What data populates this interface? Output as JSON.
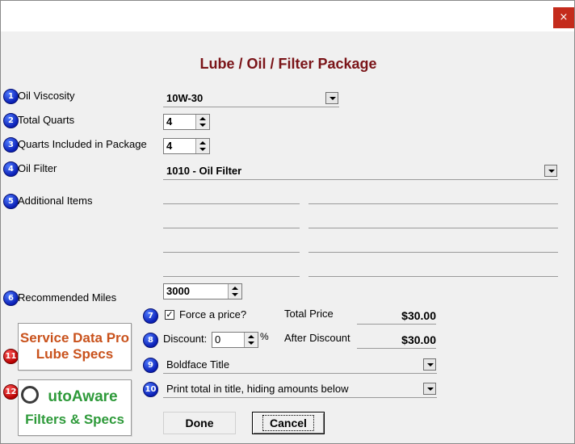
{
  "window": {
    "close_glyph": "×"
  },
  "title": "Lube / Oil / Filter Package",
  "fields": {
    "oil_viscosity": {
      "num": "1",
      "label": "Oil Viscosity",
      "value": "10W-30"
    },
    "total_quarts": {
      "num": "2",
      "label": "Total Quarts",
      "value": "4"
    },
    "quarts_included": {
      "num": "3",
      "label": "Quarts Included in Package",
      "value": "4"
    },
    "oil_filter": {
      "num": "4",
      "label": "Oil Filter",
      "value": "1010 - Oil Filter"
    },
    "additional_items": {
      "num": "5",
      "label": "Additional Items"
    },
    "recommended_miles": {
      "num": "6",
      "label": "Recommended Miles",
      "value": "3000"
    }
  },
  "pricing": {
    "force_num": "7",
    "force_label": "Force a price?",
    "force_checked_glyph": "✓",
    "total_price_label": "Total Price",
    "total_price": "$30.00",
    "discount_num": "8",
    "discount_label": "Discount:",
    "discount_value": "0",
    "percent": "%",
    "after_discount_label": "After Discount",
    "after_discount": "$30.00"
  },
  "title_style": {
    "num": "9",
    "value": "Boldface Title"
  },
  "print_option": {
    "num": "10",
    "value": "Print total in title, hiding amounts below"
  },
  "logos": {
    "service_data": {
      "num": "11",
      "line1": "Service Data Pro",
      "line2": "Lube Specs"
    },
    "autoaware": {
      "num": "12",
      "line1": "utoAware",
      "line2": "Filters & Specs"
    }
  },
  "buttons": {
    "done": "Done",
    "cancel": "Cancel"
  }
}
